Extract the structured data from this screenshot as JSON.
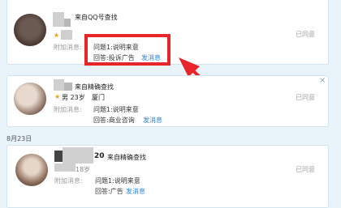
{
  "requests": [
    {
      "source": "来自QQ号查找",
      "extra_label": "附加消息:",
      "question": "问题1:说明来意",
      "answer": "回答:投诉广告",
      "send_link": "发消息",
      "status": "已同意"
    },
    {
      "source": "来自精确查找",
      "age": "男 23岁",
      "city": "厦门",
      "extra_label": "附加消息:",
      "question": "问题1:说明来意",
      "answer": "回答:商业咨询",
      "send_link": "发消息",
      "status": "已同意",
      "close": "×"
    },
    {
      "name_fragment": "20",
      "source": "来自精确查找",
      "age_fragment": "18岁",
      "extra_label": "附加消息:",
      "question": "问题1:说明来意",
      "answer": "回答:广告",
      "send_link": "发消息",
      "status": "已同意"
    }
  ],
  "date_separator": "8月23日",
  "colors": {
    "highlight": "#e8262a",
    "link": "#2a84d6"
  }
}
